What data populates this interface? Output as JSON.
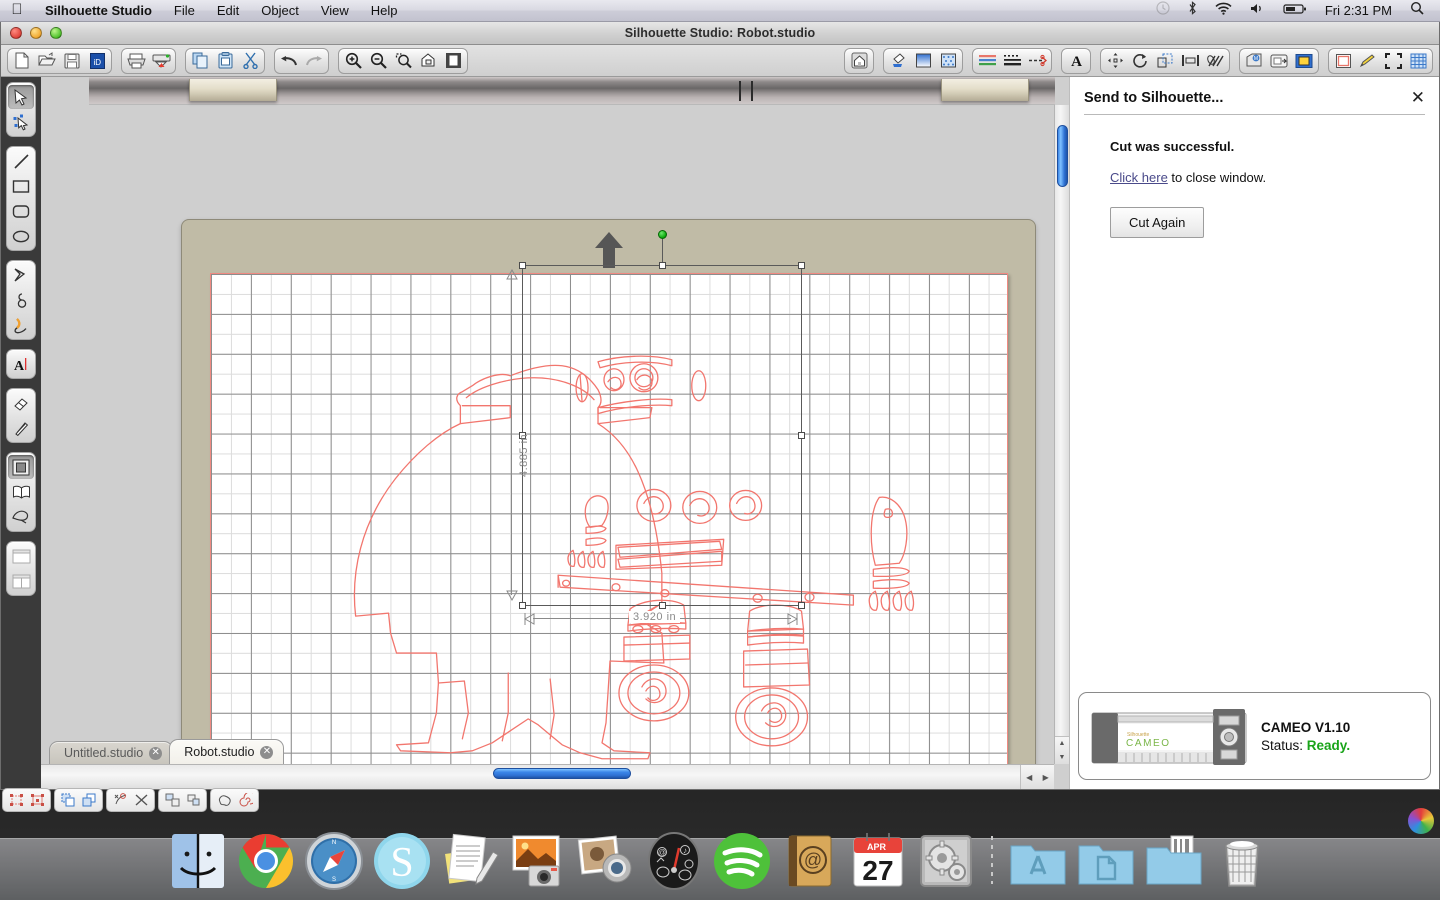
{
  "menubar": {
    "apple_icon": "apple-logo-icon",
    "app_name": "Silhouette Studio",
    "items": [
      "File",
      "Edit",
      "Object",
      "View",
      "Help"
    ],
    "status_icons": [
      "time-machine-icon",
      "bluetooth-icon",
      "wifi-icon",
      "volume-icon",
      "battery-icon"
    ],
    "clock": "Fri 2:31 PM",
    "search_icon": "spotlight-search-icon"
  },
  "window": {
    "title": "Silhouette Studio: Robot.studio",
    "controls": [
      "close-button",
      "minimize-button",
      "zoom-button"
    ]
  },
  "toolbar": {
    "groups": [
      {
        "name": "file-group",
        "buttons": [
          {
            "name": "new-document-button",
            "icon": "new-page-icon"
          },
          {
            "name": "open-document-button",
            "icon": "open-folder-icon"
          },
          {
            "name": "save-document-button",
            "icon": "floppy-save-icon"
          },
          {
            "name": "silhouette-store-button",
            "icon": "store-library-icon"
          }
        ]
      },
      {
        "name": "print-group",
        "buttons": [
          {
            "name": "print-button",
            "icon": "printer-icon"
          },
          {
            "name": "send-to-silhouette-button",
            "icon": "cutter-send-icon"
          }
        ]
      },
      {
        "name": "clipboard-group",
        "buttons": [
          {
            "name": "copy-button",
            "icon": "copy-icon"
          },
          {
            "name": "paste-button",
            "icon": "paste-icon"
          },
          {
            "name": "cut-button",
            "icon": "scissors-icon"
          }
        ]
      },
      {
        "name": "history-group",
        "buttons": [
          {
            "name": "undo-button",
            "icon": "undo-arrow-icon"
          },
          {
            "name": "redo-button",
            "icon": "redo-arrow-icon"
          }
        ]
      },
      {
        "name": "zoom-group",
        "buttons": [
          {
            "name": "zoom-in-button",
            "icon": "magnifier-plus-icon"
          },
          {
            "name": "zoom-out-button",
            "icon": "magnifier-minus-icon"
          },
          {
            "name": "zoom-selection-button",
            "icon": "magnifier-selection-icon"
          },
          {
            "name": "zoom-pan-button",
            "icon": "pan-hand-icon"
          },
          {
            "name": "fit-to-page-button",
            "icon": "fit-page-icon"
          }
        ]
      },
      {
        "name": "home-group",
        "buttons": [
          {
            "name": "design-home-button",
            "icon": "house-icon"
          }
        ]
      },
      {
        "name": "fill-group",
        "buttons": [
          {
            "name": "fill-color-button",
            "icon": "paint-bucket-icon"
          },
          {
            "name": "gradient-fill-button",
            "icon": "gradient-square-icon"
          },
          {
            "name": "pattern-fill-button",
            "icon": "pattern-square-icon"
          }
        ]
      },
      {
        "name": "line-group",
        "buttons": [
          {
            "name": "line-color-button",
            "icon": "line-color-icon"
          },
          {
            "name": "line-style-button",
            "icon": "line-style-icon"
          },
          {
            "name": "cut-style-button",
            "icon": "cut-style-scissors-icon"
          }
        ]
      },
      {
        "name": "text-group",
        "buttons": [
          {
            "name": "text-style-button",
            "icon": "letter-a-icon"
          }
        ]
      },
      {
        "name": "transform-group",
        "buttons": [
          {
            "name": "move-button",
            "icon": "move-arrows-icon"
          },
          {
            "name": "rotate-button",
            "icon": "rotate-icon"
          },
          {
            "name": "scale-button",
            "icon": "scale-icon"
          },
          {
            "name": "align-button",
            "icon": "align-icon"
          },
          {
            "name": "replicate-button",
            "icon": "replicate-icon"
          }
        ]
      },
      {
        "name": "modify-group",
        "buttons": [
          {
            "name": "modify-button",
            "icon": "weld-modify-icon"
          },
          {
            "name": "offset-button",
            "icon": "offset-icon"
          },
          {
            "name": "trace-button",
            "icon": "trace-icon"
          }
        ]
      },
      {
        "name": "page-group",
        "buttons": [
          {
            "name": "page-setup-button",
            "icon": "page-setup-icon"
          },
          {
            "name": "sketch-pens-button",
            "icon": "pen-icon"
          },
          {
            "name": "registration-marks-button",
            "icon": "registration-marks-icon"
          },
          {
            "name": "grid-settings-button",
            "icon": "grid-icon"
          }
        ]
      }
    ]
  },
  "tools": {
    "groups": [
      {
        "name": "select-group",
        "items": [
          {
            "name": "select-tool",
            "icon": "arrow-cursor-icon",
            "selected": true
          },
          {
            "name": "edit-points-tool",
            "icon": "node-edit-icon",
            "selected": false
          }
        ]
      },
      {
        "name": "shape-group",
        "items": [
          {
            "name": "line-tool",
            "icon": "line-icon",
            "selected": false
          },
          {
            "name": "rectangle-tool",
            "icon": "rectangle-icon",
            "selected": false
          },
          {
            "name": "rounded-rectangle-tool",
            "icon": "rounded-rectangle-icon",
            "selected": false
          },
          {
            "name": "ellipse-tool",
            "icon": "ellipse-icon",
            "selected": false
          }
        ]
      },
      {
        "name": "draw-group",
        "items": [
          {
            "name": "polygon-tool",
            "icon": "polygon-icon",
            "selected": false
          },
          {
            "name": "curve-tool",
            "icon": "curve-icon",
            "selected": false
          },
          {
            "name": "freehand-tool",
            "icon": "freehand-pencil-icon",
            "selected": false
          }
        ]
      },
      {
        "name": "text-group",
        "items": [
          {
            "name": "text-tool",
            "icon": "text-a-icon",
            "selected": false
          }
        ]
      },
      {
        "name": "erase-group",
        "items": [
          {
            "name": "eraser-tool",
            "icon": "eraser-icon",
            "selected": false
          },
          {
            "name": "knife-tool",
            "icon": "knife-icon",
            "selected": false
          }
        ]
      },
      {
        "name": "panel-group",
        "items": [
          {
            "name": "design-page-tool",
            "icon": "design-page-icon",
            "selected": true
          },
          {
            "name": "library-tool",
            "icon": "open-book-library-icon",
            "selected": false
          },
          {
            "name": "store-tool",
            "icon": "store-tag-icon",
            "selected": false
          }
        ]
      },
      {
        "name": "view-group",
        "items": [
          {
            "name": "single-view-tool",
            "icon": "single-pane-icon",
            "selected": false
          },
          {
            "name": "split-view-tool",
            "icon": "split-pane-icon",
            "selected": false
          }
        ]
      }
    ]
  },
  "canvas": {
    "mat_arrow_icon": "load-direction-arrow-icon",
    "selection": {
      "width_label": "3.920 in",
      "height_label": "4.885 in",
      "rotation_handle": "rotation-handle",
      "handles": 8
    },
    "art_stroke_color": "#f2766e",
    "grid_minor_color": "#dcdcdc",
    "grid_major_color": "#8d8d8d",
    "mat_color": "#c0bba6"
  },
  "tabs": [
    {
      "name": "tab-untitled",
      "label": "Untitled.studio",
      "active": false
    },
    {
      "name": "tab-robot",
      "label": "Robot.studio",
      "active": true
    }
  ],
  "panel": {
    "title": "Send to Silhouette...",
    "close_icon": "close-x-icon",
    "message": "Cut was successful.",
    "link_text": "Click here",
    "link_suffix": " to close window.",
    "button_label": "Cut Again",
    "device": {
      "name": "CAMEO V1.10",
      "status_label": "Status:",
      "status_value": "Ready.",
      "status_color": "#1aa41a",
      "brand_small": "Silhouette",
      "brand_large": "CAMEO"
    }
  },
  "dock": {
    "items": [
      {
        "name": "dock-finder",
        "icon": "finder-icon"
      },
      {
        "name": "dock-chrome",
        "icon": "google-chrome-icon"
      },
      {
        "name": "dock-safari",
        "icon": "safari-compass-icon"
      },
      {
        "name": "dock-skype",
        "icon": "skype-icon"
      },
      {
        "name": "dock-textedit",
        "icon": "textedit-icon"
      },
      {
        "name": "dock-iphoto",
        "icon": "iphoto-icon"
      },
      {
        "name": "dock-photobooth",
        "icon": "photo-booth-icon"
      },
      {
        "name": "dock-dashboard",
        "icon": "dashboard-gauge-icon"
      },
      {
        "name": "dock-spotify",
        "icon": "spotify-icon"
      },
      {
        "name": "dock-contacts",
        "icon": "address-book-icon"
      },
      {
        "name": "dock-calendar",
        "icon": "calendar-icon"
      },
      {
        "name": "dock-system-preferences",
        "icon": "gears-preferences-icon"
      },
      {
        "name": "dock-applications-folder",
        "icon": "applications-folder-icon"
      },
      {
        "name": "dock-documents-folder",
        "icon": "documents-folder-icon"
      },
      {
        "name": "dock-downloads-folder",
        "icon": "downloads-folder-icon"
      },
      {
        "name": "dock-trash",
        "icon": "trash-can-icon"
      }
    ],
    "calendar_month": "APR",
    "calendar_day": "27"
  },
  "floating_palette": {
    "groups": [
      {
        "name": "align-palette",
        "buttons": [
          {
            "icon": "align-nodes-a-icon"
          },
          {
            "icon": "align-nodes-b-icon"
          }
        ]
      },
      {
        "name": "arrange-palette",
        "buttons": [
          {
            "icon": "arrange-front-icon"
          },
          {
            "icon": "arrange-back-icon"
          }
        ]
      },
      {
        "name": "node-palette",
        "buttons": [
          {
            "icon": "node-point-icon"
          },
          {
            "icon": "delete-node-x-icon"
          }
        ]
      },
      {
        "name": "transform-palette",
        "buttons": [
          {
            "icon": "transform-a-icon"
          },
          {
            "icon": "transform-b-icon"
          }
        ]
      },
      {
        "name": "shape-palette",
        "buttons": [
          {
            "icon": "blob-shape-icon"
          },
          {
            "icon": "spiral-shape-icon"
          }
        ]
      }
    ]
  }
}
